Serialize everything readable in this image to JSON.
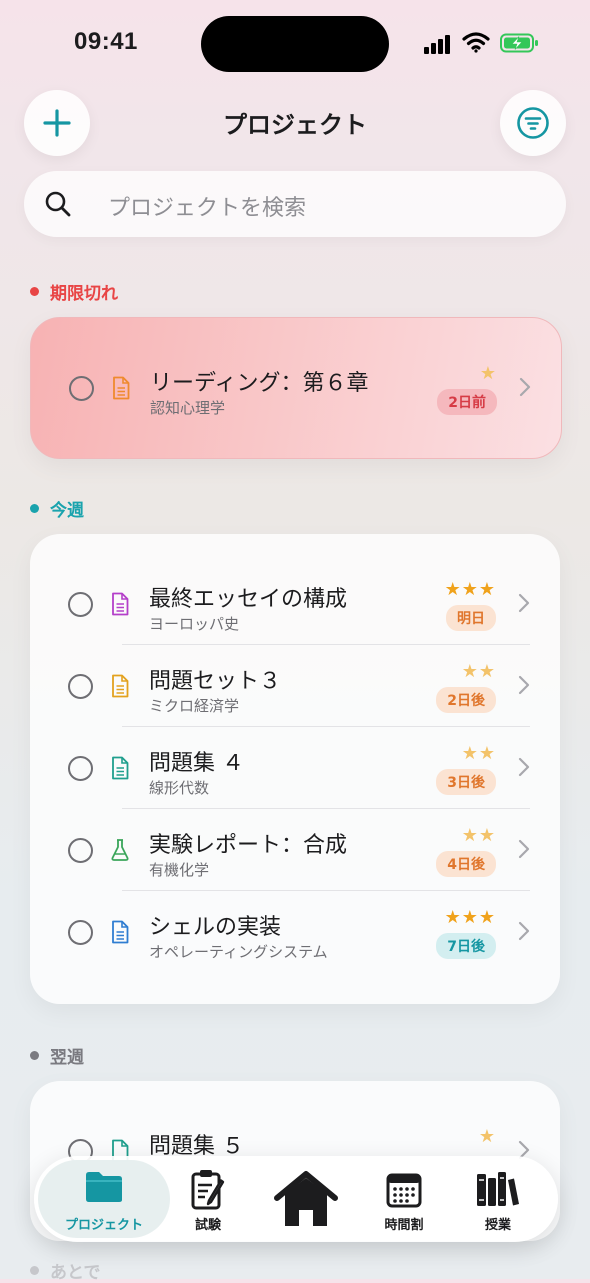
{
  "status": {
    "time": "09:41"
  },
  "header": {
    "title": "プロジェクト"
  },
  "search": {
    "placeholder": "プロジェクトを検索"
  },
  "sections": {
    "overdue": {
      "label": "期限切れ",
      "color": "#e84545"
    },
    "this_week": {
      "label": "今週",
      "color": "#1aa3ad"
    },
    "next_week": {
      "label": "翌週",
      "color": "#7a7a80"
    },
    "later": {
      "label": "あとで"
    }
  },
  "overdue_items": [
    {
      "title": "リーディング：第６章",
      "subject": "認知心理学",
      "stars": "★",
      "due": "2日前",
      "icon": "document-icon"
    }
  ],
  "week_items": [
    {
      "title": "最終エッセイの構成",
      "subject": "ヨーロッパ史",
      "stars": "★★★",
      "due": "明日",
      "icon": "document-icon"
    },
    {
      "title": "問題セット３",
      "subject": "ミクロ経済学",
      "stars": "★★",
      "due": "2日後",
      "icon": "document-icon"
    },
    {
      "title": "問題集 ４",
      "subject": "線形代数",
      "stars": "★★",
      "due": "3日後",
      "icon": "document-icon"
    },
    {
      "title": "実験レポート：合成",
      "subject": "有機化学",
      "stars": "★★",
      "due": "4日後",
      "icon": "flask-icon"
    },
    {
      "title": "シェルの実装",
      "subject": "オペレーティングシステム",
      "stars": "★★★",
      "due": "7日後",
      "icon": "document-icon"
    }
  ],
  "next_week_items": [
    {
      "title": "問題集 ５",
      "stars": "★",
      "icon": "document-icon"
    }
  ],
  "tabs": [
    {
      "label": "プロジェクト",
      "icon": "folder-icon",
      "active": true
    },
    {
      "label": "試験",
      "icon": "clipboard-icon"
    },
    {
      "label": "",
      "icon": "home-icon"
    },
    {
      "label": "時間割",
      "icon": "calendar-icon"
    },
    {
      "label": "授業",
      "icon": "books-icon"
    }
  ],
  "colors": {
    "accent": "#1596a2",
    "star": "#f0a21b",
    "overdue_badge_bg": "#f5b8bd",
    "overdue_badge_text": "#d63b45",
    "soon_badge_bg": "#fbe3d2",
    "soon_badge_text": "#e0762c",
    "week_badge_bg": "#d3eef0",
    "week_badge_text": "#1596a2"
  }
}
